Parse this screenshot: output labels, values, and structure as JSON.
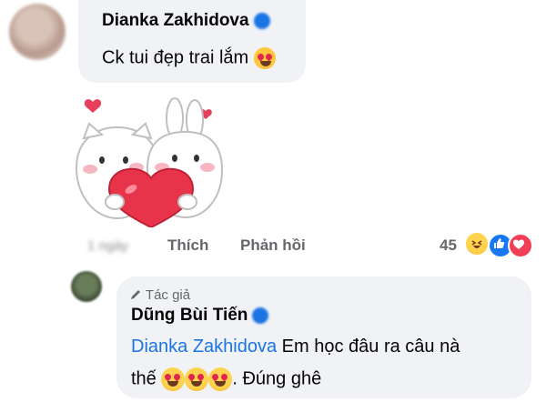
{
  "comment1": {
    "author": "Dianka Zakhidova",
    "text": "Ck tui đẹp trai lắm",
    "emoji": "smiling-cat-heart-eyes-emoji",
    "timestamp": "1 ngày",
    "like_label": "Thích",
    "reply_label": "Phản hồi",
    "reaction_count": "45",
    "reactions": [
      "haha-reaction-icon",
      "like-reaction-icon",
      "love-reaction-icon"
    ],
    "sticker": "cat-and-bunny-hugging-heart-sticker"
  },
  "reply1": {
    "badge": "Tác giả",
    "author": "Dũng Bùi Tiến",
    "mention": "Dianka Zakhidova",
    "text_line1": "Em học đâu ra câu nà",
    "text_line2_prefix": "thế",
    "text_line2_suffix": ". Đúng ghê",
    "emojis": [
      "heart-eyes-emoji",
      "heart-eyes-emoji",
      "heart-eyes-emoji"
    ]
  },
  "colors": {
    "bubble": "#f0f2f5",
    "mention": "#1b74e4",
    "meta_text": "#65676b"
  }
}
